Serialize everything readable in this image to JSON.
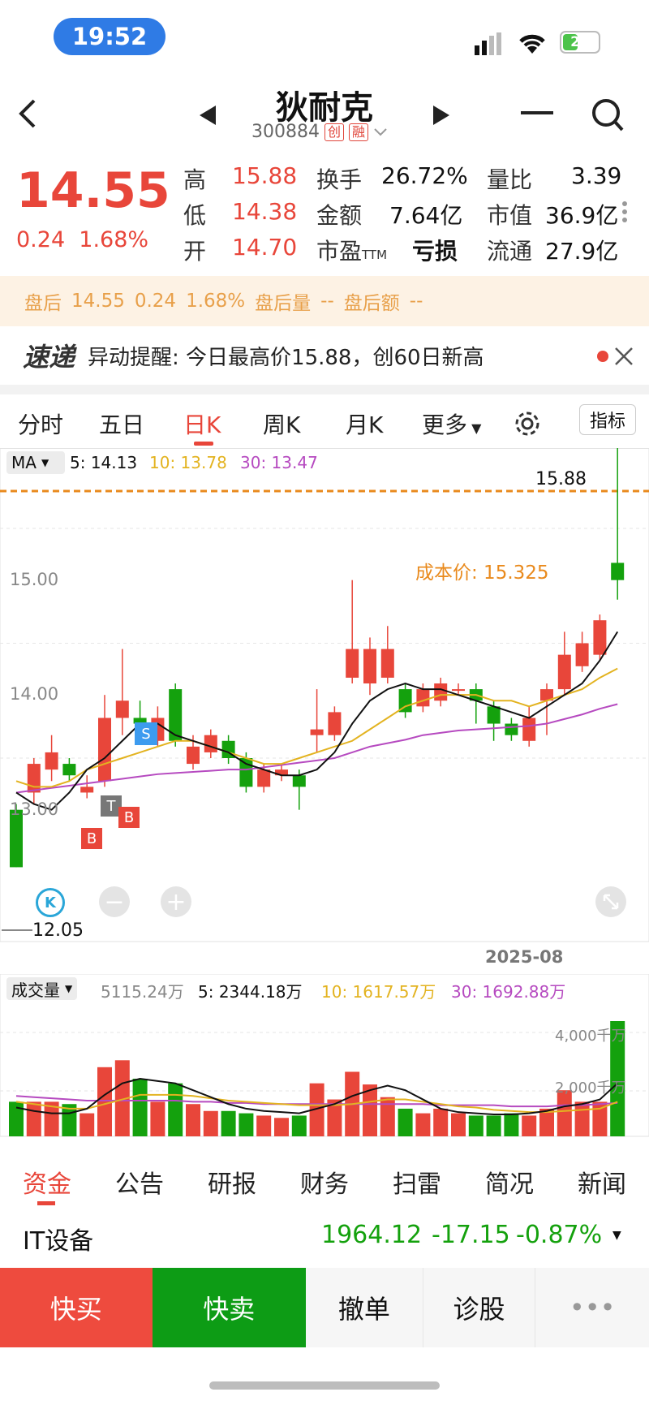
{
  "status_bar": {
    "time": "19:52",
    "battery": "27"
  },
  "header": {
    "stock_name": "狄耐克",
    "stock_code": "300884",
    "tag1": "创",
    "tag2": "融"
  },
  "quote": {
    "price": "14.55",
    "change": "0.24",
    "change_pct": "1.68%",
    "rows": [
      [
        {
          "label": "高",
          "value": "15.88"
        },
        {
          "label": "换手",
          "value": "26.72%"
        },
        {
          "label": "量比",
          "value": "3.39"
        }
      ],
      [
        {
          "label": "低",
          "value": "14.38"
        },
        {
          "label": "金额",
          "value": "7.64亿"
        },
        {
          "label": "市值",
          "value": "36.9亿"
        }
      ],
      [
        {
          "label": "开",
          "value": "14.70"
        },
        {
          "label": "市盈",
          "sub": "TTM",
          "value": "亏损"
        },
        {
          "label": "流通",
          "value": "27.9亿"
        }
      ]
    ]
  },
  "after_hours": {
    "label": "盘后",
    "price": "14.55",
    "change": "0.24",
    "pct": "1.68%",
    "vol_label": "盘后量",
    "vol_value": "--",
    "amt_label": "盘后额",
    "amt_value": "--"
  },
  "alert": {
    "logo": "速递",
    "text": "异动提醒: 今日最高价15.88，创60日新高"
  },
  "tabs": [
    "分时",
    "五日",
    "日K",
    "周K",
    "月K",
    "更多"
  ],
  "indicator_button": "指标",
  "kline": {
    "ma_label": "MA",
    "ma5": "5: 14.13",
    "ma10": "10: 13.78",
    "ma30": "30: 13.47",
    "high_label": "15.88",
    "low_label": "12.05",
    "cost_label": "成本价: 15.325",
    "y_ticks": [
      "15.00",
      "14.00",
      "13.00"
    ],
    "date_label": "2025-08",
    "markers": {
      "s": "S",
      "t": "T",
      "b": "B",
      "k": "K"
    }
  },
  "volume": {
    "label": "成交量",
    "total": "5115.24万",
    "ma5": "5: 2344.18万",
    "ma10": "10: 1617.57万",
    "ma30": "30: 1692.88万",
    "tick1": "4,000千万",
    "tick2": "2,000千万"
  },
  "footer_tabs": [
    "资金",
    "公告",
    "研报",
    "财务",
    "扫雷",
    "简况",
    "新闻"
  ],
  "sector": {
    "name": "IT设备",
    "value": "1964.12",
    "change": "-17.15",
    "pct": "-0.87%"
  },
  "actions": [
    "快买",
    "快卖",
    "撤单",
    "诊股",
    "•••"
  ],
  "colors": {
    "up": "#e8463a",
    "down": "#14a10d",
    "ma5": "#111111",
    "ma10": "#e3b320",
    "ma30": "#b64ac0",
    "cost": "#e98a1d"
  },
  "chart_data": {
    "type": "candlestick",
    "y_range": [
      12.0,
      16.0
    ],
    "candles": [
      {
        "o": 12.55,
        "c": 12.05,
        "h": 12.6,
        "l": 12.05
      },
      {
        "o": 12.7,
        "c": 12.95,
        "h": 13.0,
        "l": 12.6
      },
      {
        "o": 12.9,
        "c": 13.05,
        "h": 13.2,
        "l": 12.8
      },
      {
        "o": 12.95,
        "c": 12.85,
        "h": 13.0,
        "l": 12.8
      },
      {
        "o": 12.7,
        "c": 12.75,
        "h": 12.85,
        "l": 12.65
      },
      {
        "o": 12.8,
        "c": 13.35,
        "h": 13.55,
        "l": 12.75
      },
      {
        "o": 13.35,
        "c": 13.5,
        "h": 13.95,
        "l": 13.2
      },
      {
        "o": 13.35,
        "c": 13.3,
        "h": 13.5,
        "l": 13.2
      },
      {
        "o": 13.15,
        "c": 13.35,
        "h": 13.45,
        "l": 13.1
      },
      {
        "o": 13.6,
        "c": 13.15,
        "h": 13.65,
        "l": 13.1
      },
      {
        "o": 12.95,
        "c": 13.1,
        "h": 13.2,
        "l": 12.9
      },
      {
        "o": 13.05,
        "c": 13.2,
        "h": 13.25,
        "l": 13.0
      },
      {
        "o": 13.15,
        "c": 13.0,
        "h": 13.2,
        "l": 12.95
      },
      {
        "o": 13.0,
        "c": 12.75,
        "h": 13.05,
        "l": 12.7
      },
      {
        "o": 12.75,
        "c": 12.9,
        "h": 12.95,
        "l": 12.7
      },
      {
        "o": 12.85,
        "c": 12.9,
        "h": 12.95,
        "l": 12.8
      },
      {
        "o": 12.85,
        "c": 12.75,
        "h": 12.9,
        "l": 12.55
      },
      {
        "o": 13.2,
        "c": 13.25,
        "h": 13.6,
        "l": 13.05
      },
      {
        "o": 13.2,
        "c": 13.4,
        "h": 13.45,
        "l": 13.15
      },
      {
        "o": 13.7,
        "c": 13.95,
        "h": 14.55,
        "l": 13.65
      },
      {
        "o": 13.65,
        "c": 13.95,
        "h": 14.05,
        "l": 13.55
      },
      {
        "o": 13.7,
        "c": 13.95,
        "h": 14.15,
        "l": 13.65
      },
      {
        "o": 13.6,
        "c": 13.4,
        "h": 13.65,
        "l": 13.35
      },
      {
        "o": 13.45,
        "c": 13.6,
        "h": 13.65,
        "l": 13.4
      },
      {
        "o": 13.5,
        "c": 13.65,
        "h": 13.7,
        "l": 13.45
      },
      {
        "o": 13.6,
        "c": 13.6,
        "h": 13.65,
        "l": 13.55
      },
      {
        "o": 13.6,
        "c": 13.5,
        "h": 13.65,
        "l": 13.3
      },
      {
        "o": 13.45,
        "c": 13.3,
        "h": 13.5,
        "l": 13.15
      },
      {
        "o": 13.3,
        "c": 13.2,
        "h": 13.35,
        "l": 13.15
      },
      {
        "o": 13.15,
        "c": 13.35,
        "h": 13.45,
        "l": 13.1
      },
      {
        "o": 13.5,
        "c": 13.6,
        "h": 13.65,
        "l": 13.2
      },
      {
        "o": 13.6,
        "c": 13.9,
        "h": 14.1,
        "l": 13.55
      },
      {
        "o": 13.8,
        "c": 14.0,
        "h": 14.1,
        "l": 13.75
      },
      {
        "o": 13.9,
        "c": 14.2,
        "h": 14.25,
        "l": 13.85
      },
      {
        "o": 14.7,
        "c": 14.55,
        "h": 15.88,
        "l": 14.38
      }
    ],
    "ma5": [
      12.7,
      12.6,
      12.55,
      12.7,
      12.9,
      13.0,
      13.15,
      13.3,
      13.3,
      13.2,
      13.15,
      13.1,
      13.05,
      12.95,
      12.9,
      12.85,
      12.85,
      12.9,
      13.05,
      13.3,
      13.5,
      13.6,
      13.65,
      13.6,
      13.6,
      13.55,
      13.5,
      13.45,
      13.4,
      13.35,
      13.45,
      13.55,
      13.65,
      13.85,
      14.1
    ],
    "ma10": [
      12.8,
      12.75,
      12.75,
      12.8,
      12.9,
      12.95,
      13.0,
      13.05,
      13.1,
      13.15,
      13.15,
      13.1,
      13.05,
      13.0,
      12.95,
      12.95,
      13.0,
      13.05,
      13.1,
      13.15,
      13.25,
      13.35,
      13.45,
      13.5,
      13.55,
      13.55,
      13.55,
      13.5,
      13.5,
      13.45,
      13.5,
      13.55,
      13.6,
      13.7,
      13.78
    ],
    "ma30": [
      12.7,
      12.72,
      12.74,
      12.76,
      12.78,
      12.8,
      12.82,
      12.84,
      12.86,
      12.87,
      12.88,
      12.89,
      12.9,
      12.9,
      12.92,
      12.94,
      12.96,
      12.98,
      13.0,
      13.05,
      13.1,
      13.13,
      13.16,
      13.2,
      13.22,
      13.24,
      13.25,
      13.26,
      13.27,
      13.28,
      13.3,
      13.34,
      13.38,
      13.43,
      13.47
    ],
    "volume": [
      30,
      30,
      30,
      28,
      20,
      60,
      66,
      50,
      30,
      46,
      28,
      22,
      22,
      20,
      18,
      16,
      18,
      46,
      32,
      56,
      45,
      34,
      24,
      20,
      24,
      20,
      18,
      18,
      20,
      18,
      24,
      40,
      30,
      30,
      100
    ],
    "vol_ma5": [
      25,
      22,
      20,
      20,
      24,
      36,
      46,
      50,
      48,
      46,
      40,
      34,
      28,
      24,
      22,
      21,
      20,
      24,
      28,
      35,
      40,
      44,
      40,
      32,
      24,
      21,
      20,
      19,
      19,
      20,
      22,
      26,
      28,
      32,
      46
    ],
    "vol_ma10": [
      30,
      28,
      26,
      24,
      24,
      28,
      32,
      36,
      36,
      36,
      35,
      33,
      31,
      30,
      29,
      28,
      27,
      27,
      27,
      28,
      30,
      32,
      32,
      30,
      28,
      26,
      25,
      23,
      22,
      21,
      21,
      22,
      23,
      24,
      30
    ],
    "vol_ma30": [
      35,
      34,
      33,
      32,
      31,
      31,
      31,
      31,
      31,
      31,
      30,
      30,
      29,
      29,
      28,
      28,
      28,
      28,
      28,
      28,
      28,
      28,
      28,
      28,
      27,
      27,
      27,
      27,
      26,
      26,
      26,
      27,
      27,
      28,
      29
    ],
    "vol_range": [
      0,
      100
    ]
  }
}
